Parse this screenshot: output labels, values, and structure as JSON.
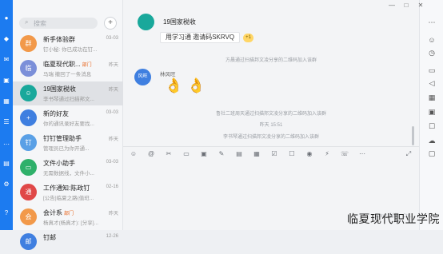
{
  "window": {
    "minimize": "—",
    "maximize": "□",
    "close": "✕"
  },
  "search": {
    "placeholder": "搜索",
    "add": "+"
  },
  "conversations": [
    {
      "name": "新手体验群",
      "tag": "",
      "time": "03-03",
      "preview": "钉小秘: 你已成功在钉...",
      "avatar_color": "#f2994a",
      "avatar_text": "群"
    },
    {
      "name": "临夏现代职...",
      "tag": "部门",
      "time": "昨天",
      "preview": "马瑞 撤回了一条消息",
      "avatar_color": "#7b8fd9",
      "avatar_text": "临"
    },
    {
      "name": "19国家税收",
      "tag": "",
      "time": "昨天",
      "preview": "李书琴通过扫描邦文...",
      "avatar_color": "#19a89b",
      "avatar_text": "☺"
    },
    {
      "name": "新的好友",
      "tag": "",
      "time": "03-03",
      "preview": "你的通讯录好友要找...",
      "avatar_color": "#3f7fe0",
      "avatar_text": "+"
    },
    {
      "name": "钉钉管理助手",
      "tag": "",
      "time": "昨天",
      "preview": "管理员已为你开通...",
      "avatar_color": "#5aa0e6",
      "avatar_text": "钉"
    },
    {
      "name": "文件小助手",
      "tag": "",
      "time": "03-03",
      "preview": "无需数据线，文件小...",
      "avatar_color": "#2fb06a",
      "avatar_text": "▭"
    },
    {
      "name": "工作通知:陈政钉",
      "tag": "",
      "time": "02-16",
      "preview": "[公告]临夏之路(值班...",
      "avatar_color": "#e04848",
      "avatar_text": "通"
    },
    {
      "name": "会计系",
      "tag": "部门",
      "time": "昨天",
      "preview": "杨真才(杨真才): [分享]...",
      "avatar_color": "#f2994a",
      "avatar_text": "会"
    },
    {
      "name": "钉邮",
      "tag": "",
      "time": "12-26",
      "preview": "",
      "avatar_color": "#3f7fe0",
      "avatar_text": "邮"
    }
  ],
  "chat": {
    "title": "19国家税收",
    "pinned": "用学习通 邀请码SKRVQ",
    "pinned_badge": "+1",
    "sys1": "方晨通过扫描邦文凌分享的二维码加入该群",
    "sender_avatar": "风旺",
    "sender_name": "林风旺",
    "emoji": "👌",
    "sys2": "鲁社二班周天通过扫描邦文凌分享的二维码加入该群",
    "time": "昨天 15:51",
    "sys3": "李书琴通过扫描邦文凌分享的二维码加入该群",
    "hint": "Enter 发送，Ctrl..."
  },
  "watermark": "临夏现代职业学院"
}
